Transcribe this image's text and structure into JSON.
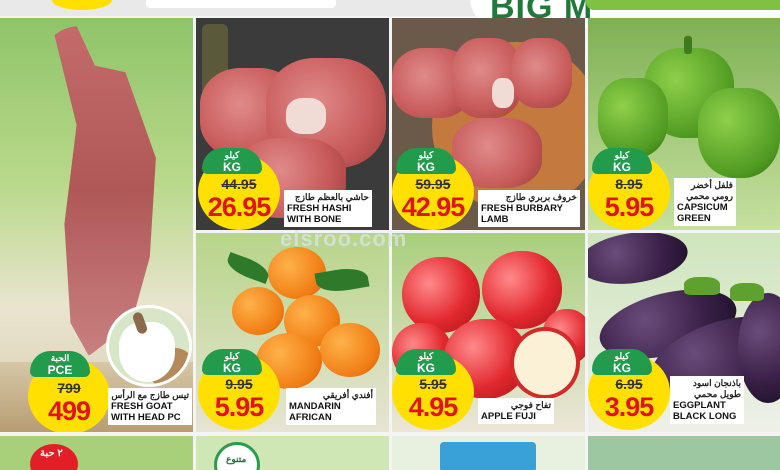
{
  "banner": {
    "title": "BIG M"
  },
  "watermark": "elsroo.com",
  "colors": {
    "price_red": "#e0141b",
    "badge_green": "#229b4c",
    "circle_yellow": "#ffe000"
  },
  "products": {
    "hashi": {
      "unit_ar": "كيلو",
      "unit_en": "KG",
      "old_price": "44.95",
      "new_price": "26.95",
      "name_ar": "حاشي بالعظم طازج",
      "name_en_1": "FRESH HASHI",
      "name_en_2": "WITH BONE"
    },
    "lamb": {
      "unit_ar": "كيلو",
      "unit_en": "KG",
      "old_price": "59.95",
      "new_price": "42.95",
      "name_ar": "خروف بربري طازج",
      "name_en_1": "FRESH BURBARY",
      "name_en_2": "LAMB"
    },
    "capsicum": {
      "unit_ar": "كيلو",
      "unit_en": "KG",
      "old_price": "8.95",
      "new_price": "5.95",
      "name_ar_1": "فلفل أخضر",
      "name_ar_2": "رومي محمي",
      "name_en_1": "CAPSICUM",
      "name_en_2": "GREEN"
    },
    "goat": {
      "unit_ar": "الحبة",
      "unit_en": "PCE",
      "old_price": "799",
      "new_price": "499",
      "name_ar": "تيس طازج مع الرأس",
      "name_en_1": "FRESH GOAT",
      "name_en_2": "WITH HEAD PC"
    },
    "mandarin": {
      "unit_ar": "كيلو",
      "unit_en": "KG",
      "old_price": "9.95",
      "new_price": "5.95",
      "name_ar": "أفندي أفريقي",
      "name_en_1": "MANDARIN",
      "name_en_2": "AFRICAN"
    },
    "apple": {
      "unit_ar": "كيلو",
      "unit_en": "KG",
      "old_price": "5.95",
      "new_price": "4.95",
      "name_ar": "تفاح فوجي",
      "name_en_1": "APPLE FUJI"
    },
    "eggplant": {
      "unit_ar": "كيلو",
      "unit_en": "KG",
      "old_price": "6.95",
      "new_price": "3.95",
      "name_ar_1": "باذنجان اسود",
      "name_ar_2": "طويل محمي",
      "name_en_1": "EGGPLANT",
      "name_en_2": "BLACK LONG"
    }
  },
  "bottom": {
    "badge_1": "٢ حبة",
    "badge_2": "متنوع"
  },
  "icons": [
    "goat-photo-icon",
    "leaf-icon"
  ]
}
